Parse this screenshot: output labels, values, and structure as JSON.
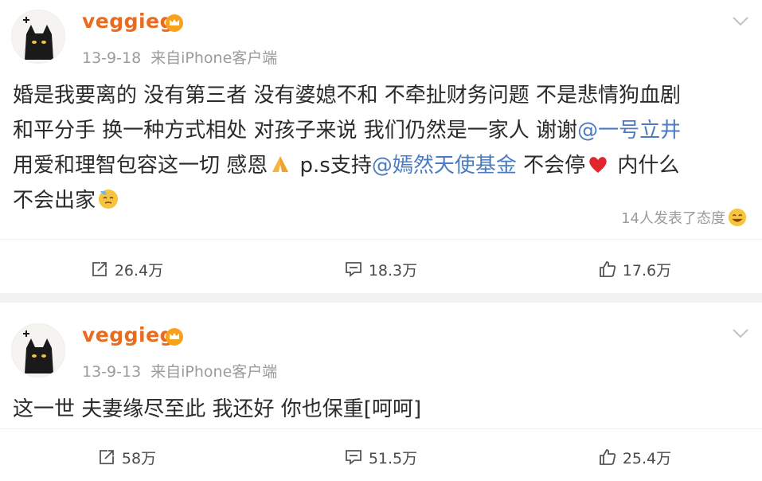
{
  "posts": [
    {
      "username": "veggieg",
      "date": "13-9-18",
      "source": "来自iPhone客户端",
      "lines": [
        [
          "婚是我要离的 没有第三者 没有婆媳不和 不牵扯财务问题 不是悲情狗血剧"
        ],
        [
          "和平分手 换一种方式相处 对孩子来说 我们仍然是一家人 谢谢",
          "@一号立井"
        ],
        [
          "用爱和理智包容这一切 感恩",
          " p.s支持",
          "@嫣然天使基金",
          " 不会停",
          " 内什么"
        ],
        [
          "不会出家"
        ]
      ],
      "reactions": "14人发表了态度",
      "repost_count": "26.4万",
      "comment_count": "18.3万",
      "like_count": "17.6万"
    },
    {
      "username": "veggieg",
      "date": "13-9-13",
      "source": "来自iPhone客户端",
      "text": "这一世 夫妻缘尽至此 我还好 你也保重[呵呵]",
      "repost_count": "58万",
      "comment_count": "51.5万",
      "like_count": "25.4万"
    }
  ],
  "icons": {
    "avatar": "black-cat-avatar",
    "badge": "crown-badge-icon",
    "menu": "chevron-down-icon",
    "pray": "pray-emoji",
    "heart": "red-heart-emoji",
    "sweat": "sweat-face-emoji",
    "grin": "grin-face-emoji",
    "repost": "repost-icon",
    "comment": "comment-icon",
    "like": "thumbs-up-icon"
  },
  "colors": {
    "username": "#e86b1f",
    "mention": "#4b7bc0",
    "meta": "#9b9b9b",
    "background": "#f2f2f2"
  }
}
